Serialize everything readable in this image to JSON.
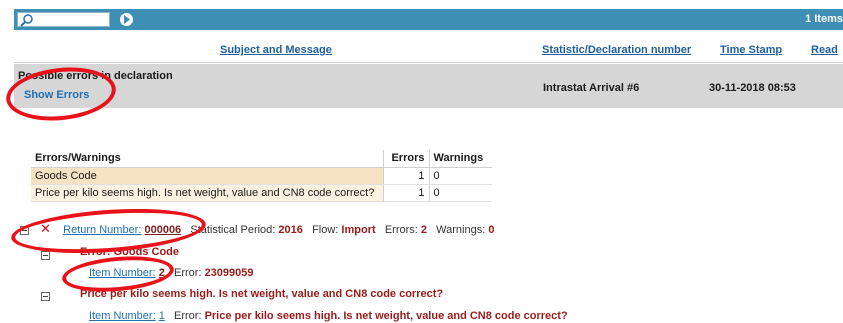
{
  "toolbar": {
    "items_count": "1 Items",
    "search_value": ""
  },
  "columns": {
    "subject": "Subject and Message",
    "statistic": "Statistic/Declaration number",
    "time": "Time Stamp",
    "read": "Read"
  },
  "message": {
    "subject": "Possible errors in declaration",
    "show_errors": "Show Errors",
    "statistic": "Intrastat Arrival #6",
    "timestamp": "30-11-2018 08:53"
  },
  "errors_table": {
    "headers": {
      "name": "Errors/Warnings",
      "errors": "Errors",
      "warnings": "Warnings"
    },
    "rows": [
      {
        "name": "Goods Code",
        "errors": "1",
        "warnings": "0"
      },
      {
        "name": "Price per kilo seems high. Is net weight, value and CN8 code correct?",
        "errors": "1",
        "warnings": "0"
      }
    ]
  },
  "tree": {
    "return": {
      "label": "Return Number:",
      "number": "000006",
      "period_label": "Statistical Period:",
      "period": "2016",
      "flow_label": "Flow:",
      "flow": "Import",
      "errors_label": "Errors:",
      "errors": "2",
      "warnings_label": "Warnings:",
      "warnings": "0"
    },
    "group1": {
      "title": "Error: Goods Code",
      "item_label": "Item Number:",
      "item_number": "2",
      "error_label": "Error:",
      "error_value": "23099059"
    },
    "group2": {
      "title": "Price per kilo seems high. Is net weight, value and CN8 code correct?",
      "item_label": "Item Number:",
      "item_number": "1",
      "error_label": "Error:",
      "error_value": "Price per kilo seems high. Is net weight, value and CN8 code correct?"
    }
  },
  "colors": {
    "toolbar": "#3d8fb3",
    "annotation": "#e8131a",
    "link": "#1f6fb5",
    "value_red": "#9b1b1b"
  }
}
